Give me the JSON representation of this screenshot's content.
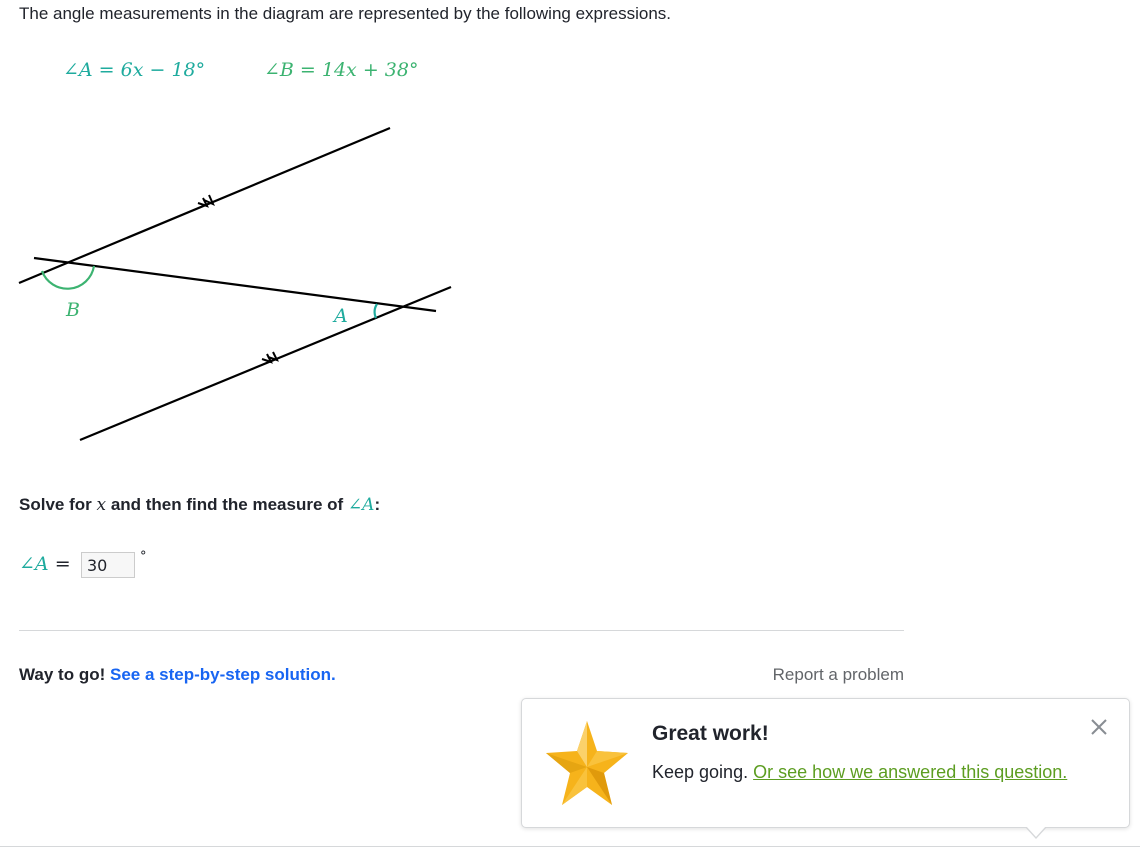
{
  "prompt_text": "The angle measurements in the diagram are represented by the following expressions.",
  "expressions": {
    "angle_a": "∠A = 6x − 18°",
    "angle_b": "∠B = 14x + 38°"
  },
  "diagram": {
    "label_b": "B",
    "label_a": "A",
    "colors": {
      "angle_a": "#1fab9e",
      "angle_b": "#3cb371",
      "lines": "#000000"
    }
  },
  "question": {
    "prefix": "Solve for",
    "variable": "x",
    "middle": "and then find the measure of",
    "angle": "∠A",
    "suffix": ":"
  },
  "answer": {
    "label": "∠A",
    "equals": "=",
    "value": "30",
    "degree": "°"
  },
  "feedback": {
    "message": "Way to go!",
    "solution_link": "See a step-by-step solution.",
    "report_link": "Report a problem"
  },
  "toast": {
    "title": "Great work!",
    "body": "Keep going.",
    "link": "Or see how we answered this question.",
    "icons": {
      "star": "star-icon",
      "close": "close-icon"
    },
    "colors": {
      "link": "#5c9d21",
      "star": "#f6b31b"
    }
  }
}
